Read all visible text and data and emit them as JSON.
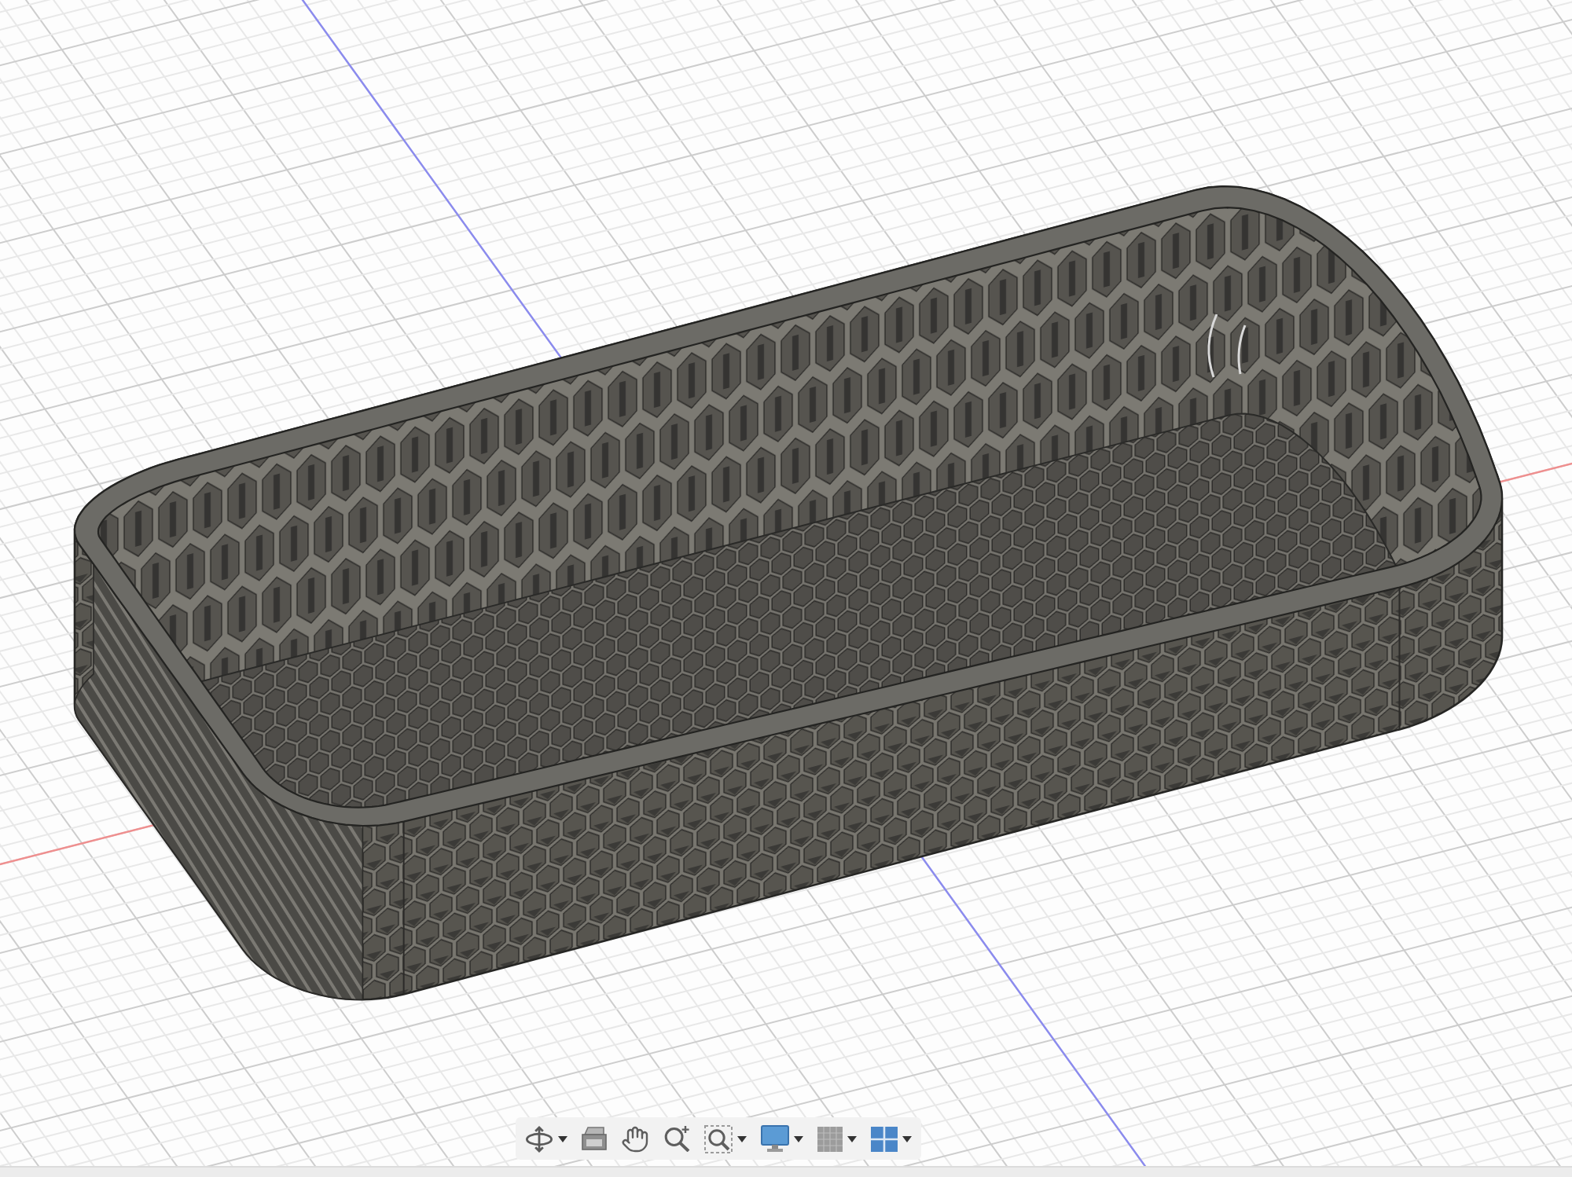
{
  "viewport": {
    "axes": [
      {
        "kind": "x",
        "color": "#ef8f8f"
      },
      {
        "kind": "z",
        "color": "#8b8bef"
      }
    ]
  },
  "navigation_bar": {
    "items": [
      {
        "kind": "orbit",
        "dropdown": true
      },
      {
        "kind": "look_at",
        "dropdown": false
      },
      {
        "kind": "pan",
        "dropdown": false
      },
      {
        "kind": "zoom",
        "dropdown": false
      },
      {
        "kind": "zoom_window",
        "dropdown": true
      },
      {
        "kind": "display",
        "dropdown": true
      },
      {
        "kind": "grid",
        "dropdown": true
      },
      {
        "kind": "viewports",
        "dropdown": true
      }
    ]
  }
}
